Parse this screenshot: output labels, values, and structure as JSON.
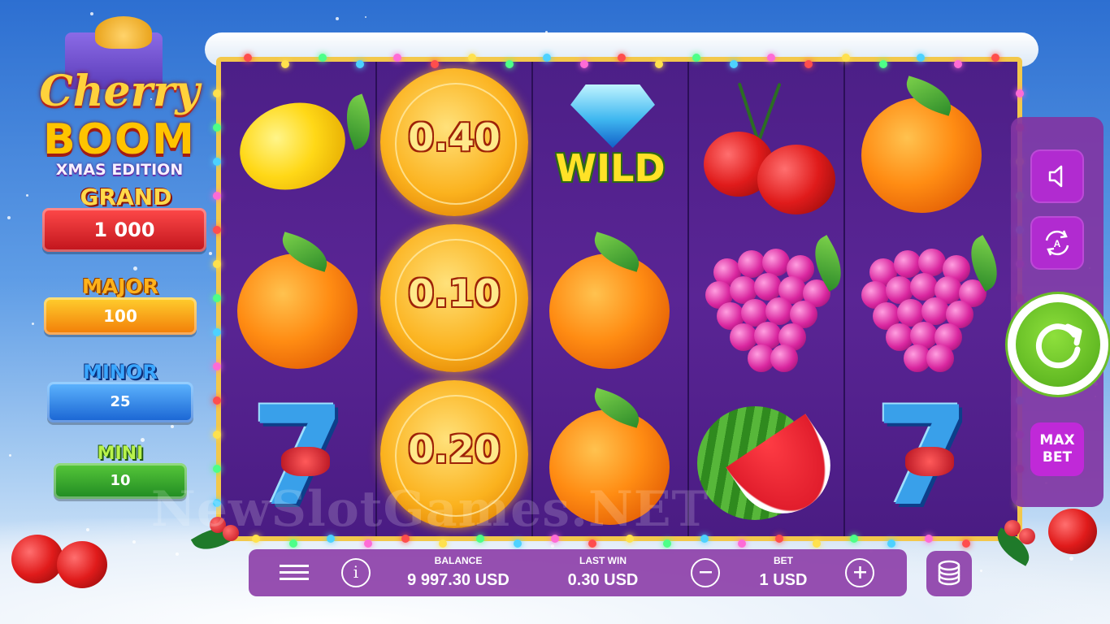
{
  "game": {
    "logo": {
      "line1": "Cherry",
      "line2": "BOOM",
      "line3": "XMAS EDITION"
    }
  },
  "jackpots": [
    {
      "name": "GRAND",
      "value": "1 000",
      "color": "#d8232a"
    },
    {
      "name": "MAJOR",
      "value": "100",
      "color": "#f28a0c"
    },
    {
      "name": "MINOR",
      "value": "25",
      "color": "#1d79db"
    },
    {
      "name": "MINI",
      "value": "10",
      "color": "#2f9b2a"
    }
  ],
  "reels": [
    [
      "lemon",
      "orange",
      "seven"
    ],
    [
      "coin",
      "coin",
      "coin"
    ],
    [
      "wild",
      "orange",
      "orange"
    ],
    [
      "cherry",
      "grapes",
      "watermelon"
    ],
    [
      "orange",
      "grapes",
      "seven"
    ]
  ],
  "coin_values": [
    "0.40",
    "0.10",
    "0.20"
  ],
  "wild_label": "WILD",
  "side_panel": {
    "sound_icon": "speaker-icon",
    "autoplay_icon": "autoplay-icon",
    "spin_icon": "spin-arrow-icon",
    "maxbet_line1": "MAX",
    "maxbet_line2": "BET"
  },
  "bottom_bar": {
    "menu_icon": "hamburger-menu-icon",
    "info_icon": "info-icon",
    "balance_label": "BALANCE",
    "balance_value": "9 997.30 USD",
    "lastwin_label": "LAST WIN",
    "lastwin_value": "0.30 USD",
    "bet_label": "BET",
    "bet_value": "1 USD",
    "minus_icon": "minus-icon",
    "plus_icon": "plus-icon",
    "coins_icon": "coin-stack-icon"
  },
  "watermark": "NewSlotGames.NET",
  "colors": {
    "accent_purple": "#8e42aa",
    "spin_green": "#5cb81f",
    "frame_gold": "#f3c84b"
  }
}
